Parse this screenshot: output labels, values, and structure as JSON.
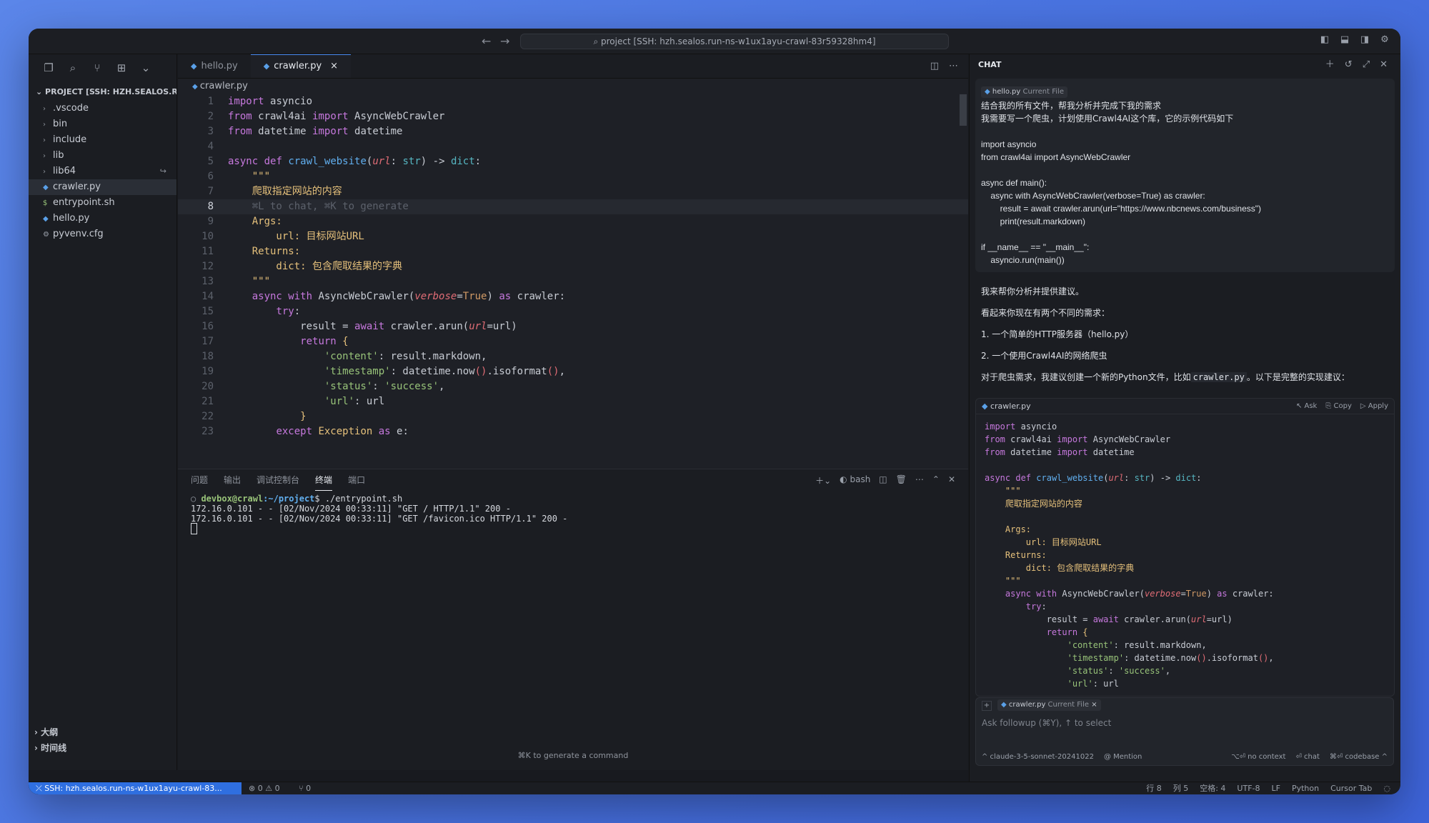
{
  "titlebar": {
    "command_center": "project [SSH: hzh.sealos.run-ns-w1ux1ayu-crawl-83r59328hm4]",
    "back": "←",
    "forward": "→"
  },
  "sidebar": {
    "header": "PROJECT [SSH: HZH.SEALOS.R...",
    "items": [
      {
        "label": ".vscode",
        "type": "folder"
      },
      {
        "label": "bin",
        "type": "folder"
      },
      {
        "label": "include",
        "type": "folder"
      },
      {
        "label": "lib",
        "type": "folder"
      },
      {
        "label": "lib64",
        "type": "folder",
        "badge": "↪"
      },
      {
        "label": "crawler.py",
        "type": "py"
      },
      {
        "label": "entrypoint.sh",
        "type": "sh"
      },
      {
        "label": "hello.py",
        "type": "py"
      },
      {
        "label": "pyvenv.cfg",
        "type": "cfg"
      }
    ],
    "outline": "大纲",
    "timeline": "时间线"
  },
  "editor": {
    "tabs": [
      {
        "label": "hello.py"
      },
      {
        "label": "crawler.py",
        "close": "×"
      }
    ],
    "breadcrumb": "crawler.py",
    "inline_hint": "⌘L to chat, ⌘K to generate",
    "line_numbers": [
      "1",
      "2",
      "3",
      "4",
      "5",
      "6",
      "7",
      "8",
      "9",
      "10",
      "11",
      "12",
      "13",
      "14",
      "15",
      "16",
      "17",
      "18",
      "19",
      "20",
      "21",
      "22",
      "23"
    ]
  },
  "panel": {
    "tabs": [
      "问题",
      "输出",
      "调试控制台",
      "终端",
      "端口"
    ],
    "shell": "bash",
    "prompt_user": "devbox@crawl",
    "prompt_path": ":~/project",
    "command": "$ ./entrypoint.sh",
    "log1": "172.16.0.101 - - [02/Nov/2024 00:33:11] \"GET / HTTP/1.1\" 200 -",
    "log2": "172.16.0.101 - - [02/Nov/2024 00:33:11] \"GET /favicon.ico HTTP/1.1\" 200 -",
    "hint": "⌘K to generate a command"
  },
  "status": {
    "ssh": "SSH: hzh.sealos.run-ns-w1ux1ayu-crawl-83...",
    "problems": "⊗ 0 ⚠ 0",
    "ports": "⑂ 0",
    "right": [
      "行 8",
      "列 5",
      "空格: 4",
      "UTF-8",
      "LF",
      "Python",
      "Cursor Tab"
    ]
  },
  "chat": {
    "title": "CHAT",
    "user_context": "hello.py",
    "user_context_tag": "Current File",
    "user_text1": "结合我的所有文件，帮我分析并完成下我的需求",
    "user_text2": "我需要写一个爬虫，计划使用Crawl4AI这个库，它的示例代码如下",
    "user_code": "import asyncio\nfrom crawl4ai import AsyncWebCrawler\n\nasync def main():\n    async with AsyncWebCrawler(verbose=True) as crawler:\n        result = await crawler.arun(url=\"https://www.nbcnews.com/business\")\n        print(result.markdown)\n\nif __name__ == \"__main__\":\n    asyncio.run(main())",
    "a1": "我来帮你分析并提供建议。",
    "a2": "看起来你现在有两个不同的需求：",
    "a3": "1. 一个简单的HTTP服务器（hello.py）",
    "a4": "2. 一个使用Crawl4AI的网络爬虫",
    "a5_pre": "对于爬虫需求，我建议创建一个新的Python文件，比如",
    "a5_code": "crawler.py",
    "a5_post": "。以下是完整的实现建议：",
    "block_file": "crawler.py",
    "block_ask": "↖ Ask",
    "block_copy": "⎘ Copy",
    "block_apply": "▷ Apply",
    "input_ctx": "crawler.py",
    "input_ctx_tag": "Current File",
    "input_placeholder": "Ask followup (⌘Y), ↑ to select",
    "model": "^ claude-3-5-sonnet-20241022",
    "mention": "@ Mention",
    "no_context": "⌥⏎ no context",
    "chat_btn": "⏎ chat",
    "codebase": "⌘⏎ codebase ^"
  }
}
